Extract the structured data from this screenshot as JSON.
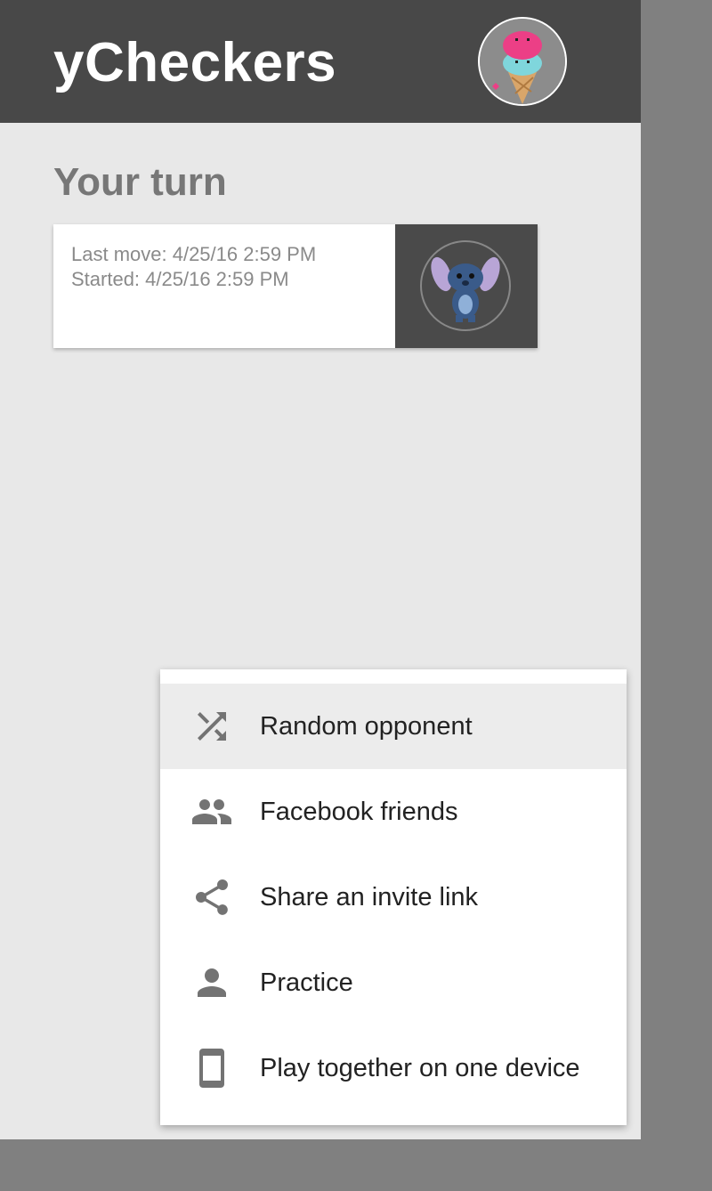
{
  "header": {
    "title": "yCheckers",
    "avatar_icon": "ice-cream-avatar"
  },
  "main": {
    "section_title": "Your turn",
    "games": [
      {
        "last_move": "Last move: 4/25/16 2:59 PM",
        "started": "Started: 4/25/16 2:59 PM",
        "opponent_avatar_icon": "stitch-avatar"
      }
    ]
  },
  "new_game_menu": {
    "items": [
      {
        "label": "Random opponent",
        "icon": "shuffle-icon",
        "highlighted": true
      },
      {
        "label": "Facebook friends",
        "icon": "group-icon",
        "highlighted": false
      },
      {
        "label": "Share an invite link",
        "icon": "share-icon",
        "highlighted": false
      },
      {
        "label": "Practice",
        "icon": "person-icon",
        "highlighted": false
      },
      {
        "label": "Play together on one device",
        "icon": "phone-icon",
        "highlighted": false
      }
    ]
  },
  "colors": {
    "topbar": "#484848",
    "background": "#e8e8e8",
    "overlay": "#808080",
    "icon": "#737373"
  }
}
